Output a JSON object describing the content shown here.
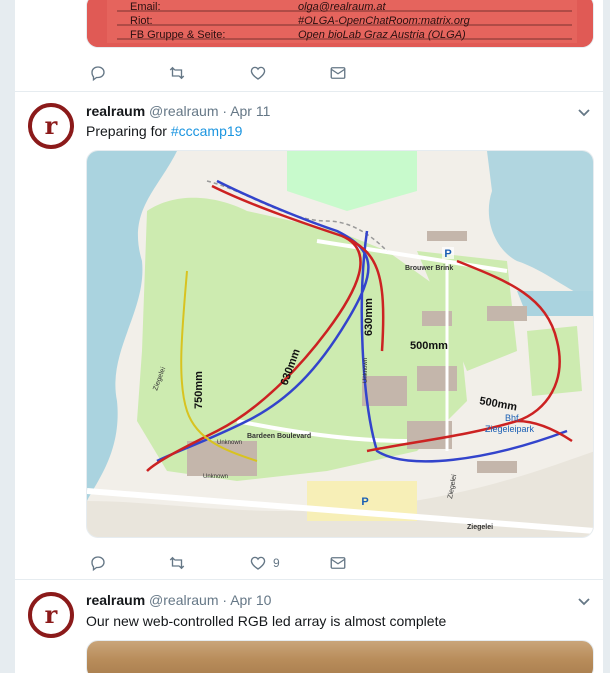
{
  "colors": {
    "accent": "#1b95e0",
    "muted": "#657786",
    "avatar_red": "#8b1a1a"
  },
  "tweet_top": {
    "card": {
      "rows": [
        {
          "label": "Email:",
          "value": "olga@realraum.at"
        },
        {
          "label": "Riot:",
          "value": "#OLGA-OpenChatRoom:matrix.org"
        },
        {
          "label": "FB Gruppe & Seite:",
          "value": "Open bioLab Graz Austria (OLGA)"
        }
      ]
    },
    "actions": {
      "reply_icon": "reply-icon",
      "retweet_icon": "retweet-icon",
      "like_icon": "heart-icon",
      "dm_icon": "envelope-icon"
    }
  },
  "tweet1": {
    "avatar_letter": "r",
    "name": "realraum",
    "handle": "@realraum",
    "dot": "·",
    "date": "Apr 11",
    "text_prefix": "Preparing for ",
    "hashtag": "#cccamp19",
    "map": {
      "labels": {
        "brouwer_brink": "Brouwer Brink",
        "m500a": "500mm",
        "m500b": "500mm",
        "m630a": "630mm",
        "m630b": "630mm",
        "m750": "750mm",
        "bardeen": "Bardeen Boulevard",
        "ziegelei_a": "Ziegelei",
        "ziegelei_b": "Ziegelei",
        "ziegelei_c": "Ziegelei",
        "bhf": "Bhf.",
        "ziegeleipark": "Ziegeleipark",
        "unknown": "Unknown",
        "parking": "P"
      }
    },
    "like_count": "9"
  },
  "tweet2": {
    "avatar_letter": "r",
    "name": "realraum",
    "handle": "@realraum",
    "dot": "·",
    "date": "Apr 10",
    "text": "Our new web-controlled RGB led array is almost complete"
  }
}
